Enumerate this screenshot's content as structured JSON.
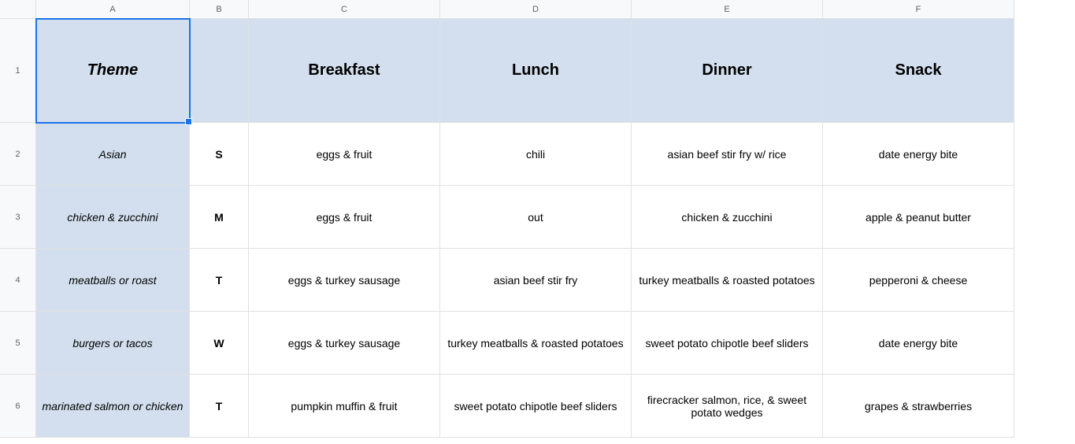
{
  "columns": [
    "A",
    "B",
    "C",
    "D",
    "E",
    "F"
  ],
  "rowNumbers": [
    "1",
    "2",
    "3",
    "4",
    "5",
    "6"
  ],
  "headers": {
    "theme": "Theme",
    "day": "",
    "breakfast": "Breakfast",
    "lunch": "Lunch",
    "dinner": "Dinner",
    "snack": "Snack"
  },
  "rows": [
    {
      "theme": "Asian",
      "day": "S",
      "breakfast": "eggs & fruit",
      "lunch": "chili",
      "dinner": "asian beef stir fry w/ rice",
      "snack": "date energy bite"
    },
    {
      "theme": "chicken & zucchini",
      "day": "M",
      "breakfast": "eggs & fruit",
      "lunch": "out",
      "dinner": "chicken & zucchini",
      "snack": "apple & peanut butter"
    },
    {
      "theme": "meatballs or roast",
      "day": "T",
      "breakfast": "eggs & turkey sausage",
      "lunch": "asian beef stir fry",
      "dinner": "turkey meatballs & roasted potatoes",
      "snack": "pepperoni & cheese"
    },
    {
      "theme": "burgers or tacos",
      "day": "W",
      "breakfast": "eggs & turkey sausage",
      "lunch": "turkey meatballs & roasted potatoes",
      "dinner": "sweet potato chipotle beef sliders",
      "snack": "date energy bite"
    },
    {
      "theme": "marinated salmon or chicken",
      "day": "T",
      "breakfast": "pumpkin muffin & fruit",
      "lunch": "sweet potato chipotle beef sliders",
      "dinner": "firecracker salmon, rice, & sweet potato wedges",
      "snack": "grapes & strawberries"
    }
  ]
}
